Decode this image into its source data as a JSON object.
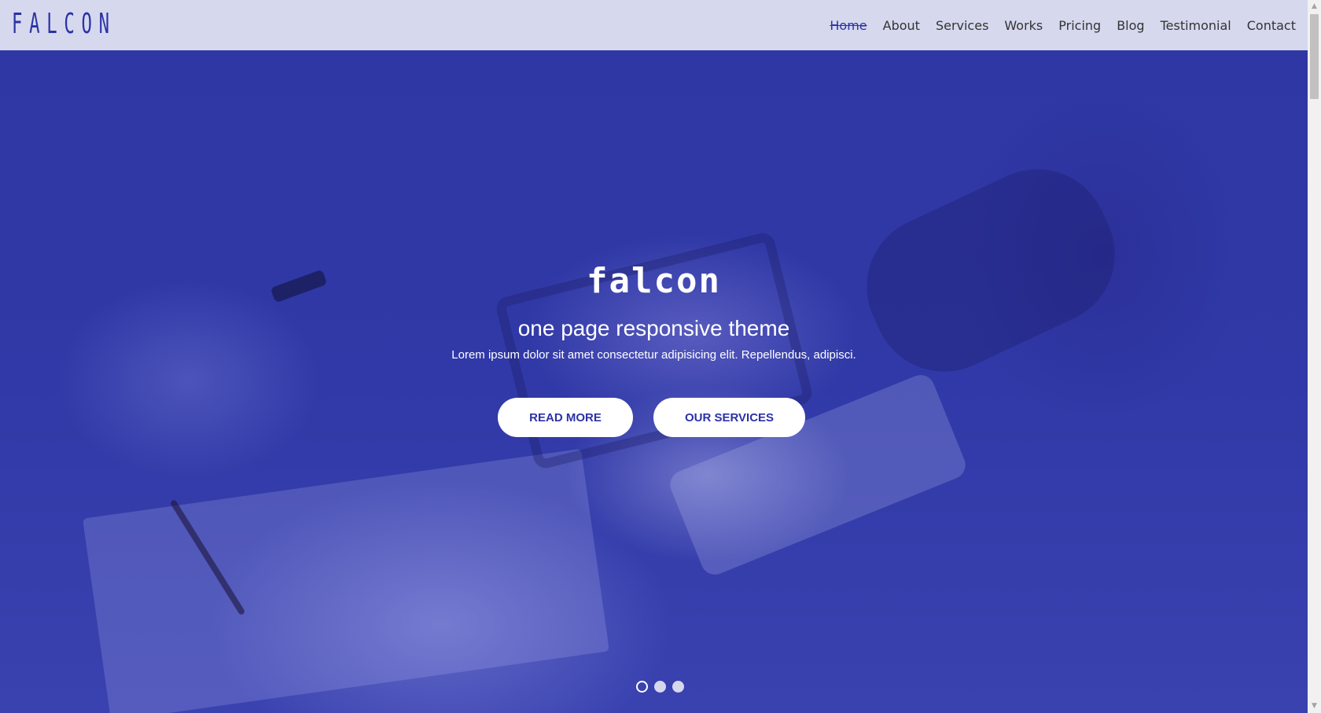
{
  "brand": {
    "logo": "FALCON",
    "color": "#2b32a6"
  },
  "nav": {
    "items": [
      {
        "label": "Home",
        "active": true
      },
      {
        "label": "About"
      },
      {
        "label": "Services"
      },
      {
        "label": "Works"
      },
      {
        "label": "Pricing"
      },
      {
        "label": "Blog"
      },
      {
        "label": "Testimonial"
      },
      {
        "label": "Contact"
      }
    ]
  },
  "hero": {
    "title": "falcon",
    "subtitle": "one page responsive theme",
    "text": "Lorem ipsum dolor sit amet consectetur adipisicing elit. Repellendus, adipisci.",
    "buttons": {
      "read_more": "READ MORE",
      "our_services": "OUR SERVICES"
    },
    "slider": {
      "count": 3,
      "active_index": 0
    }
  },
  "scrollbar": {
    "up_icon": "triangle-up-icon",
    "down_icon": "triangle-down-icon"
  }
}
